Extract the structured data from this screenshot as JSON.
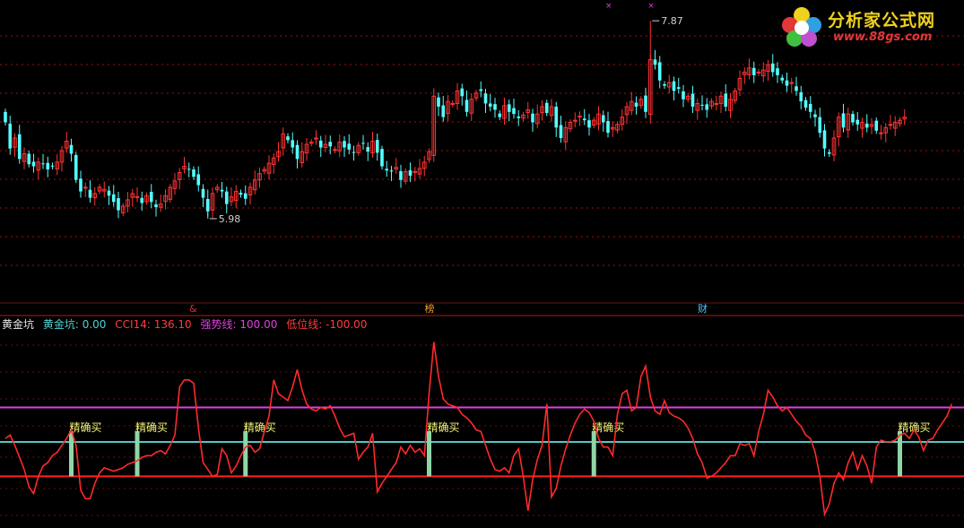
{
  "watermark": {
    "title": "分析家公式网",
    "url": "www.88gs.com"
  },
  "indicator_legend": {
    "name": "黄金坑",
    "items": [
      {
        "label": "黄金坑:",
        "value": "0.00",
        "color": "#50d2d2"
      },
      {
        "label": "CCI14:",
        "value": "136.10",
        "color": "#ff3c3c"
      },
      {
        "label": "强势线:",
        "value": "100.00",
        "color": "#e040e0"
      },
      {
        "label": "低位线:",
        "value": "-100.00",
        "color": "#ff3c3c"
      }
    ]
  },
  "colors": {
    "up": "#ff3232",
    "down": "#54ffff",
    "grid": "#a01010",
    "magenta": "#e040e0",
    "cyan_line": "#50c8c8",
    "signal": "#8fd6a6",
    "signal_text": "#f5f578"
  },
  "chart_data": [
    {
      "type": "candlestick",
      "title": "",
      "ylim": [
        5.5,
        8.0
      ],
      "annotations": {
        "high_label": "7.87",
        "low_label": "5.98",
        "high_value": 7.87,
        "low_value": 5.98
      },
      "x_markers": [
        {
          "index": 40,
          "label": "&",
          "color": "#d83030"
        },
        {
          "index": 90,
          "label": "榜",
          "color": "#f0a030"
        },
        {
          "index": 148,
          "label": "财",
          "color": "#50c8ff"
        }
      ],
      "top_marks": [
        128,
        137
      ],
      "close": [
        6.9,
        6.65,
        6.75,
        6.55,
        6.6,
        6.5,
        6.48,
        6.52,
        6.5,
        6.45,
        6.48,
        6.52,
        6.63,
        6.72,
        6.6,
        6.35,
        6.24,
        6.28,
        6.18,
        6.22,
        6.28,
        6.26,
        6.2,
        6.14,
        6.06,
        6.1,
        6.16,
        6.22,
        6.19,
        6.13,
        6.2,
        6.14,
        6.09,
        6.12,
        6.2,
        6.28,
        6.34,
        6.42,
        6.48,
        6.45,
        6.38,
        6.3,
        6.18,
        6.05,
        6.22,
        6.28,
        6.24,
        6.12,
        6.19,
        6.24,
        6.21,
        6.17,
        6.28,
        6.35,
        6.41,
        6.45,
        6.51,
        6.56,
        6.62,
        6.79,
        6.73,
        6.66,
        6.55,
        6.62,
        6.69,
        6.71,
        6.75,
        6.66,
        6.69,
        6.67,
        6.64,
        6.71,
        6.66,
        6.64,
        6.61,
        6.68,
        6.7,
        6.62,
        6.72,
        6.61,
        6.48,
        6.44,
        6.43,
        6.47,
        6.35,
        6.43,
        6.39,
        6.43,
        6.46,
        6.52,
        6.62,
        7.15,
        7.05,
        6.95,
        7.1,
        7.08,
        7.2,
        7.15,
        7.0,
        7.12,
        7.18,
        7.2,
        7.08,
        7.05,
        7.02,
        6.95,
        7.06,
        7.0,
        6.98,
        6.94,
        6.97,
        7.02,
        6.9,
        6.98,
        7.05,
        6.99,
        7.05,
        6.85,
        6.75,
        6.85,
        6.9,
        6.92,
        6.96,
        6.92,
        6.85,
        6.92,
        6.98,
        6.9,
        6.8,
        6.85,
        6.88,
        6.95,
        7.05,
        7.1,
        7.05,
        7.12,
        7.0,
        7.5,
        7.45,
        7.3,
        7.25,
        7.28,
        7.2,
        7.22,
        7.12,
        7.15,
        7.05,
        7.08,
        7.06,
        7.02,
        7.1,
        7.08,
        7.15,
        7.05,
        7.12,
        7.2,
        7.32,
        7.38,
        7.42,
        7.35,
        7.38,
        7.4,
        7.45,
        7.38,
        7.35,
        7.3,
        7.25,
        7.28,
        7.2,
        7.1,
        7.04,
        7.0,
        6.95,
        6.8,
        6.65,
        6.6,
        6.75,
        6.95,
        6.85,
        6.98,
        6.9,
        6.88,
        6.9,
        6.85,
        6.88,
        6.82,
        6.8,
        6.85,
        6.88,
        6.9,
        6.92,
        6.95
      ]
    },
    {
      "type": "line",
      "title": "",
      "ylim": [
        -250,
        320
      ],
      "reference_lines": [
        {
          "name": "强势线",
          "value": 100
        },
        {
          "name": "黄金坑",
          "value": 0
        },
        {
          "name": "低位线",
          "value": -100
        }
      ],
      "buy_signal_label": "精确买",
      "buy_signal_indices": [
        14,
        28,
        51,
        90,
        125,
        190
      ],
      "series": [
        {
          "name": "CCI14",
          "values": [
            10,
            20,
            -10,
            -45,
            -80,
            -130,
            -150,
            -100,
            -70,
            -60,
            -40,
            -30,
            -10,
            10,
            35,
            -10,
            -140,
            -165,
            -165,
            -120,
            -90,
            -75,
            -80,
            -85,
            -80,
            -75,
            -65,
            -60,
            -55,
            -45,
            -40,
            -40,
            -30,
            -25,
            -35,
            -10,
            20,
            160,
            180,
            180,
            170,
            40,
            -60,
            -80,
            -100,
            -95,
            -20,
            -40,
            -90,
            -70,
            -40,
            -15,
            -10,
            -30,
            -20,
            30,
            75,
            180,
            140,
            130,
            120,
            160,
            210,
            150,
            110,
            95,
            90,
            100,
            95,
            105,
            75,
            40,
            15,
            20,
            25,
            -50,
            -30,
            -15,
            25,
            -145,
            -120,
            -100,
            -80,
            -60,
            -15,
            -35,
            -10,
            -30,
            -20,
            -40,
            140,
            290,
            190,
            125,
            110,
            105,
            100,
            80,
            70,
            55,
            35,
            30,
            -10,
            -50,
            -80,
            -85,
            -75,
            -90,
            -40,
            -20,
            -100,
            -200,
            -110,
            -50,
            -10,
            110,
            -160,
            -135,
            -70,
            -20,
            20,
            55,
            80,
            95,
            85,
            60,
            10,
            -15,
            -15,
            -40,
            80,
            140,
            150,
            90,
            100,
            190,
            220,
            130,
            90,
            80,
            120,
            85,
            75,
            70,
            60,
            40,
            10,
            -35,
            -60,
            -105,
            -100,
            -90,
            -75,
            -60,
            -40,
            -40,
            -5,
            -10,
            -5,
            -40,
            30,
            80,
            150,
            130,
            105,
            90,
            100,
            80,
            60,
            45,
            20,
            10,
            -30,
            -100,
            -210,
            -180,
            -120,
            -90,
            -110,
            -60,
            -30,
            -80,
            -40,
            -70,
            -120,
            -15,
            5,
            0,
            0,
            5,
            20,
            25,
            10,
            35,
            15,
            -25,
            5,
            10,
            35,
            55,
            75,
            110
          ]
        }
      ]
    }
  ]
}
